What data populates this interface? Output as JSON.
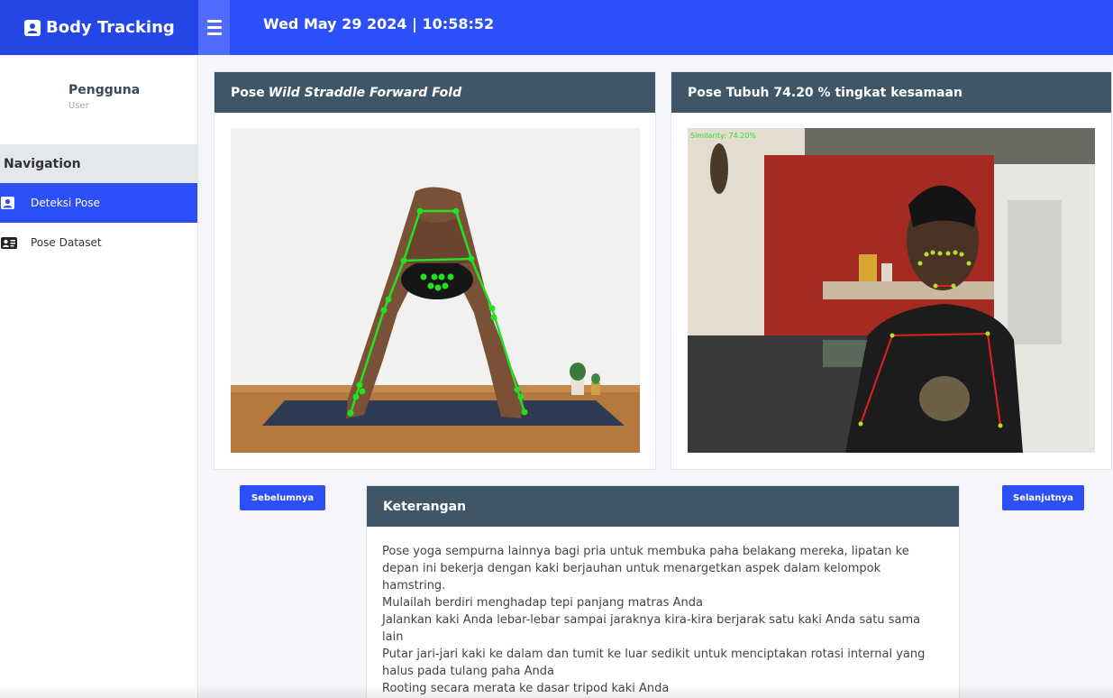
{
  "brand": {
    "title": "Body Tracking",
    "icon": "id-badge-icon"
  },
  "header": {
    "datetime": "Wed May 29 2024 | 10:58:52"
  },
  "user": {
    "name": "Pengguna",
    "role": "User"
  },
  "navigation": {
    "heading": "Navigation",
    "items": [
      {
        "label": "Deteksi Pose",
        "icon": "user-square-icon",
        "active": true
      },
      {
        "label": "Pose Dataset",
        "icon": "id-card-icon",
        "active": false
      }
    ]
  },
  "reference_card": {
    "title_prefix": "Pose",
    "title_pose": "Wild Straddle Forward Fold"
  },
  "camera_card": {
    "title": "Pose Tubuh 74.20 % tingkat kesamaan",
    "overlay_text": "Similarity: 74.20%"
  },
  "buttons": {
    "prev": "Sebelumnya",
    "next": "Selanjutnya"
  },
  "description": {
    "title": "Keterangan",
    "lines": [
      "Pose yoga sempurna lainnya bagi pria untuk membuka paha belakang mereka, lipatan ke depan ini bekerja dengan kaki berjauhan untuk menargetkan aspek dalam kelompok hamstring.",
      "Mulailah berdiri menghadap tepi panjang matras Anda",
      "Jalankan kaki Anda lebar-lebar sampai jaraknya kira-kira berjarak satu kaki Anda satu sama lain",
      "Putar jari-jari kaki ke dalam dan tumit ke luar sedikit untuk menciptakan rotasi internal yang halus pada tulang paha Anda",
      "Rooting secara merata ke dasar tripod kaki Anda"
    ]
  },
  "colors": {
    "primary": "#2c4ffa",
    "brand_bg": "#2446e6",
    "card_header": "#3f5668",
    "skeleton_ref": "#22e022",
    "skeleton_cam_body": "#e02020",
    "skeleton_cam_points": "#b8e020"
  }
}
